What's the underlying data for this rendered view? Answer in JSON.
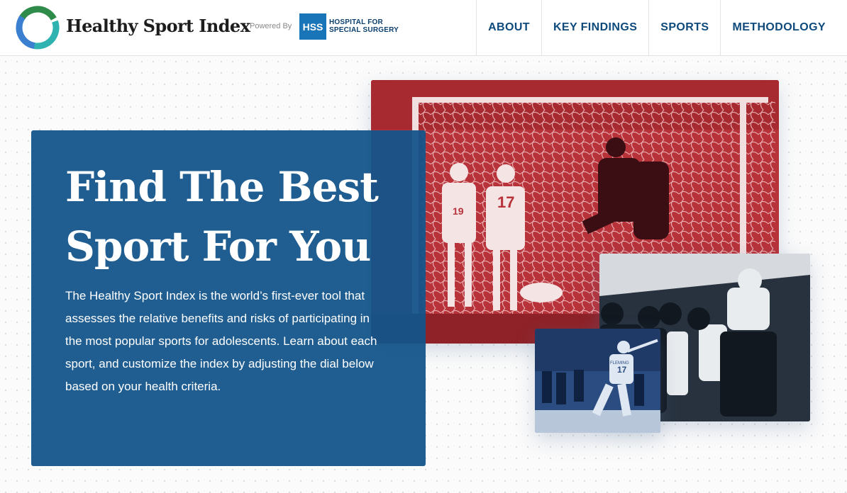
{
  "header": {
    "logo_text": "Healthy Sport Index",
    "powered_by": "Powered By",
    "partner_abbr": "HSS",
    "partner_name": "HOSPITAL FOR SPECIAL SURGERY"
  },
  "nav": {
    "items": [
      {
        "label": "ABOUT"
      },
      {
        "label": "KEY FINDINGS"
      },
      {
        "label": "SPORTS"
      },
      {
        "label": "METHODOLOGY"
      }
    ]
  },
  "hero": {
    "title_line1": "Find The Best",
    "title_line2": "Sport For You",
    "description": "The Healthy Sport Index is the world’s first-ever tool that assesses the relative benefits and risks of participating in the most popular sports for adolescents. Learn about each sport, and customize the index by adjusting the dial below based on your health criteria."
  },
  "photos": {
    "soccer_jersey_1": "19",
    "soccer_jersey_2": "17",
    "baseball_jersey": "17",
    "baseball_name": "FLEMING"
  },
  "colors": {
    "brand_blue": "#12548a",
    "nav_text": "#0e4a7c",
    "soccer_tint": "#c0343a",
    "football_tint": "#2b3a4e",
    "baseball_tint": "#2c5a99",
    "logo_green": "#2e8b4a",
    "logo_teal": "#2fb3b0",
    "logo_blue": "#3a7fd0"
  }
}
